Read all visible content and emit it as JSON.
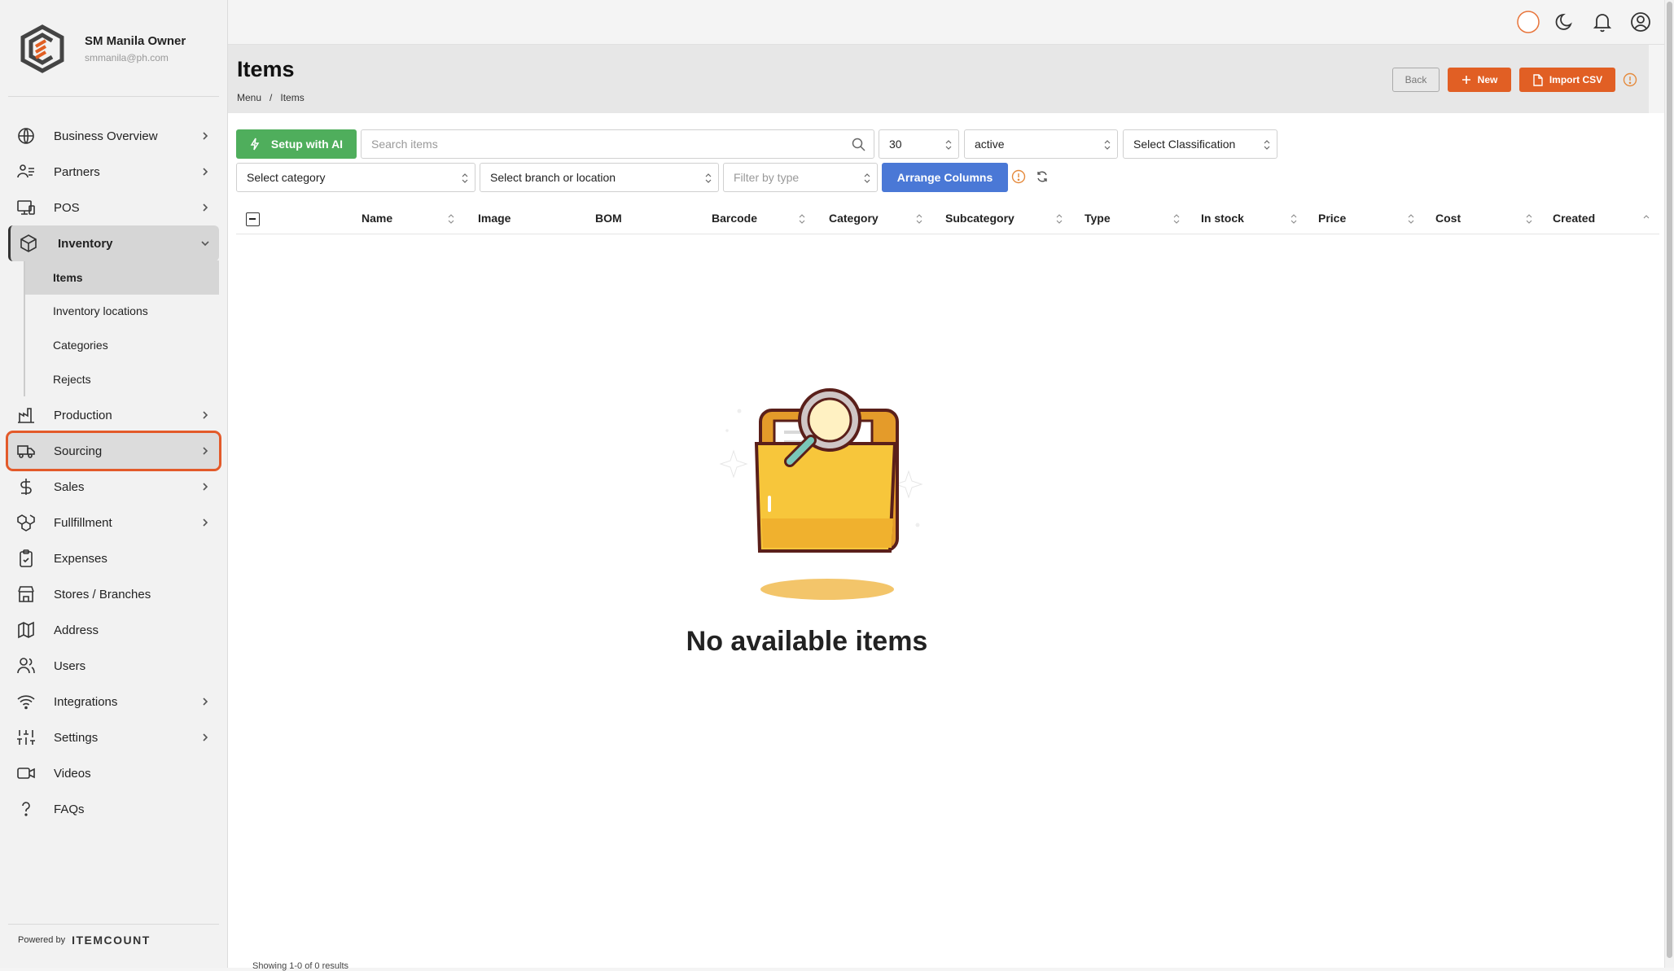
{
  "user": {
    "name": "SM Manila Owner",
    "email": "smmanila@ph.com"
  },
  "sidebar": {
    "items": [
      {
        "label": "Business Overview",
        "icon": "globe-icon"
      },
      {
        "label": "Partners",
        "icon": "partners-icon"
      },
      {
        "label": "POS",
        "icon": "pos-icon"
      },
      {
        "label": "Inventory",
        "icon": "box-icon"
      },
      {
        "label": "Production",
        "icon": "factory-icon"
      },
      {
        "label": "Sourcing",
        "icon": "truck-icon"
      },
      {
        "label": "Sales",
        "icon": "dollar-icon"
      },
      {
        "label": "Fullfillment",
        "icon": "boxes-icon"
      },
      {
        "label": "Expenses",
        "icon": "clipboard-icon"
      },
      {
        "label": "Stores / Branches",
        "icon": "store-icon"
      },
      {
        "label": "Address",
        "icon": "map-icon"
      },
      {
        "label": "Users",
        "icon": "users-icon"
      },
      {
        "label": "Integrations",
        "icon": "wifi-icon"
      },
      {
        "label": "Settings",
        "icon": "sliders-icon"
      },
      {
        "label": "Videos",
        "icon": "video-icon"
      },
      {
        "label": "FAQs",
        "icon": "question-icon"
      }
    ],
    "inventory_sub": [
      "Items",
      "Inventory locations",
      "Categories",
      "Rejects"
    ],
    "powered_by": "Powered by",
    "powered_brand": "ITEMCOUNT"
  },
  "header": {
    "title": "Items",
    "breadcrumb": [
      "Menu",
      "Items"
    ],
    "back_label": "Back",
    "new_label": "New",
    "import_label": "Import CSV"
  },
  "toolbar": {
    "setup_ai_label": "Setup with AI",
    "search_placeholder": "Search items",
    "page_size": "30",
    "status": "active",
    "classification": "Select Classification",
    "category": "Select category",
    "branch": "Select branch or location",
    "type_placeholder": "Filter by type",
    "arrange_label": "Arrange Columns"
  },
  "table": {
    "columns": [
      "Name",
      "Image",
      "BOM",
      "Barcode",
      "Category",
      "Subcategory",
      "Type",
      "In stock",
      "Price",
      "Cost",
      "Created"
    ]
  },
  "empty": {
    "message": "No available items"
  },
  "footer": {
    "results": "Showing 1-0 of 0 results"
  },
  "colors": {
    "accent": "#e15f24",
    "ai_green": "#4fae5c",
    "arrange_blue": "#4a78d6"
  }
}
